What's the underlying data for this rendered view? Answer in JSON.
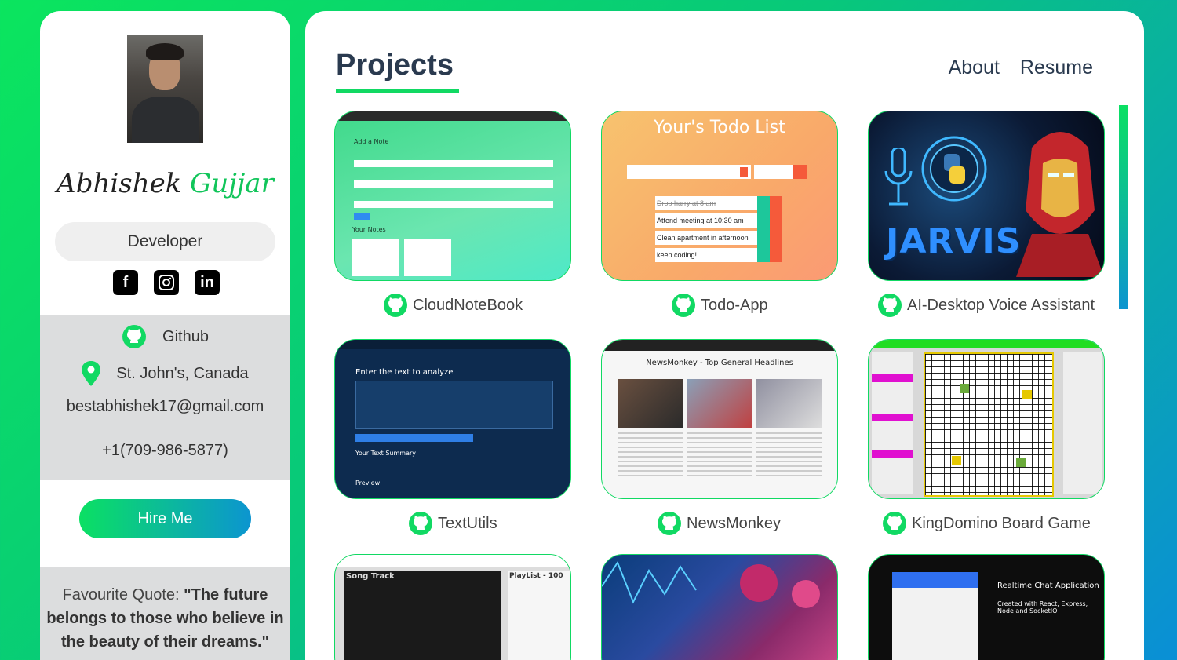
{
  "profile": {
    "first_name": "Abhishek",
    "last_name": "Gujjar",
    "role": "Developer",
    "socials": [
      "facebook-icon",
      "instagram-icon",
      "linkedin-icon"
    ],
    "github_label": "Github",
    "location": "St. John's, Canada",
    "email": "bestabhishek17@gmail.com",
    "phone": "+1(709-986-5877)",
    "hire_label": "Hire Me",
    "quote_label": "Favourite Quote: ",
    "quote": "\"The future belongs to those who believe in the beauty of their dreams.\""
  },
  "main": {
    "title": "Projects",
    "nav": [
      "About",
      "Resume"
    ],
    "projects": [
      {
        "name": "CloudNoteBook",
        "thumb_text": "Add a Note",
        "thumb_text2": "Your Notes"
      },
      {
        "name": "Todo-App",
        "thumb_text": "Your's Todo List",
        "items": [
          "Drop harry at 8 am",
          "Attend meeting at 10:30 am",
          "Clean apartment in afternoon",
          "keep coding!"
        ]
      },
      {
        "name": "AI-Desktop Voice Assistant",
        "thumb_text": "JARVIS"
      },
      {
        "name": "TextUtils",
        "thumb_text": "Enter the text to analyze",
        "thumb_text2": "Your Text Summary",
        "thumb_text3": "Preview"
      },
      {
        "name": "NewsMonkey",
        "thumb_text": "NewsMonkey - Top General Headlines"
      },
      {
        "name": "KingDomino Board Game"
      },
      {
        "name": "",
        "thumb_text": "Song Track",
        "thumb_text2": "PlayList - 100"
      },
      {
        "name": ""
      },
      {
        "name": "",
        "thumb_text": "Realtime Chat Application",
        "thumb_text2": "Created with React, Express, Node and SocketIO"
      }
    ]
  },
  "colors": {
    "accent_green": "#11d963",
    "accent_blue": "#0c95d0",
    "title": "#2a3a4f"
  }
}
